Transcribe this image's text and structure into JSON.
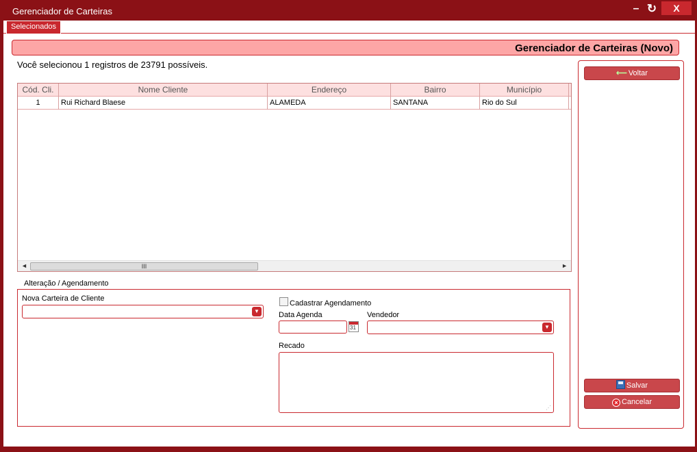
{
  "window": {
    "title": "Gerenciador de Carteiras",
    "minimize_glyph": "–",
    "refresh_glyph": "↻",
    "close_glyph": "X"
  },
  "tabs": [
    {
      "label": "Selecionados",
      "selected": true
    }
  ],
  "header": {
    "title": "Gerenciador de Carteiras (Novo)"
  },
  "selection_text": "Você selecionou 1 registros de 23791 possíveis.",
  "grid": {
    "columns": [
      "Cód. Cli.",
      "Nome Cliente",
      "Endereço",
      "Bairro",
      "Município"
    ],
    "rows": [
      [
        "1",
        "Rui Richard Blaese",
        "ALAMEDA",
        "SANTANA",
        "Rio do Sul"
      ]
    ],
    "scroll": {
      "left_arrow": "◄",
      "thumb_glyph": "III",
      "right_arrow": "►"
    }
  },
  "form": {
    "group_legend": "Alteração / Agendamento",
    "nova_carteira_label": "Nova Carteira de Cliente",
    "nova_carteira_value": "",
    "cadastrar_label": "Cadastrar Agendamento",
    "cadastrar_checked": false,
    "data_agenda_label": "Data Agenda",
    "data_agenda_value": "",
    "calendar_day": "31",
    "vendedor_label": "Vendedor",
    "vendedor_value": "",
    "recado_label": "Recado",
    "recado_value": "",
    "dropdown_glyph": "▼"
  },
  "side": {
    "voltar_label": "Voltar",
    "salvar_label": "Salvar",
    "cancelar_label": "Cancelar"
  },
  "colors": {
    "accent": "#c9282e",
    "frame": "#8b1116",
    "header_bg": "#fda6a6"
  }
}
